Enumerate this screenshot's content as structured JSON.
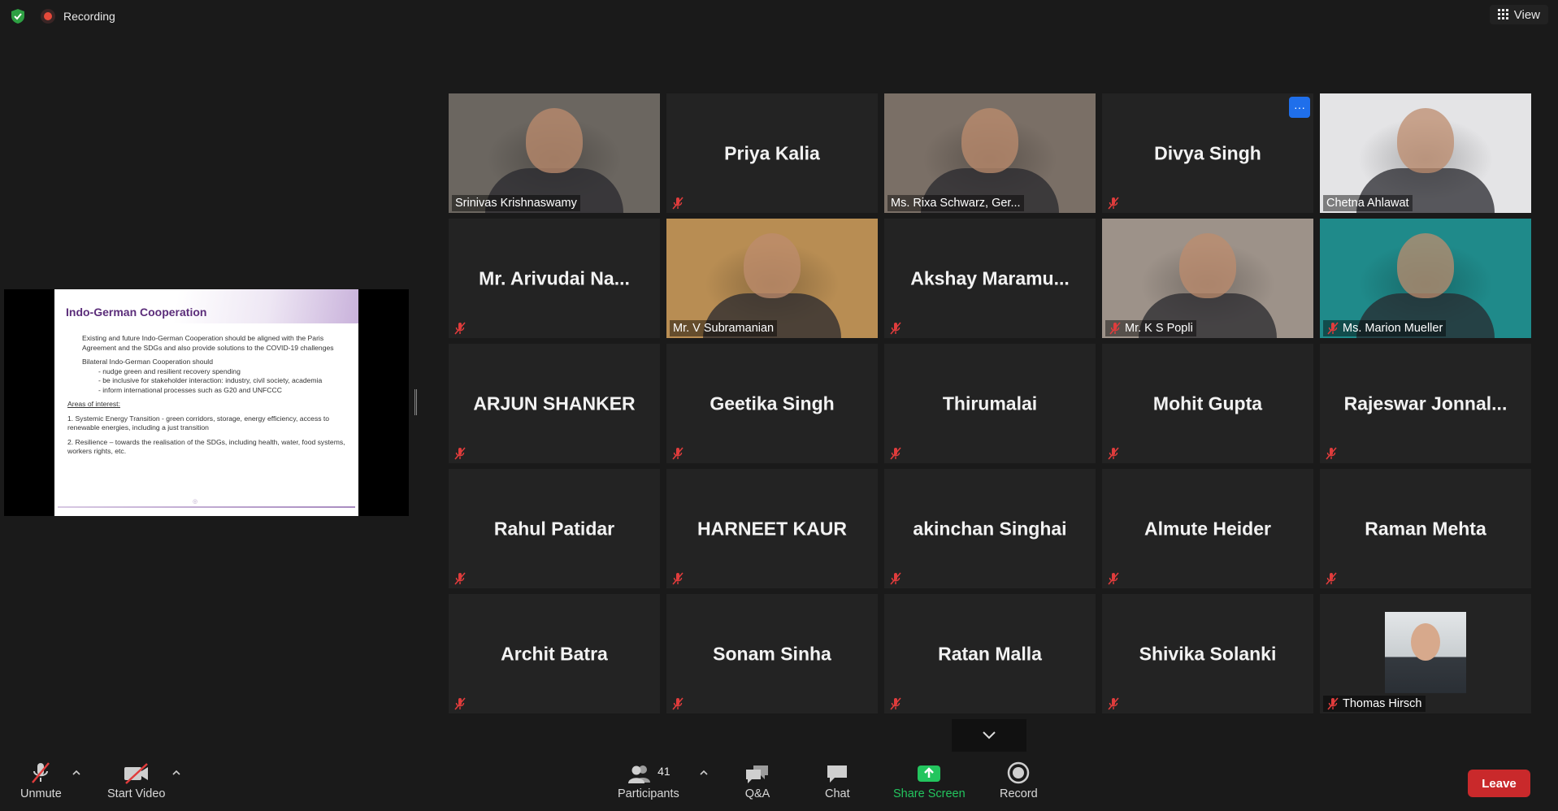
{
  "top": {
    "recording": "Recording",
    "view": "View"
  },
  "slide": {
    "title": "Indo-German Cooperation",
    "bullet1": "Existing and future Indo-German Cooperation should be aligned with the Paris Agreement and the SDGs and also provide solutions to the COVID-19 challenges",
    "bullet2": "Bilateral Indo-German Cooperation should",
    "sub1": "- nudge green and resilient recovery spending",
    "sub2": "- be inclusive for stakeholder interaction: industry, civil society, academia",
    "sub3": "- inform international processes such as G20 and UNFCCC",
    "areas_heading": "Areas of interest:",
    "area1": "1.   Systemic Energy Transition - green corridors, storage, energy efficiency, access to renewable energies, including a just transition",
    "area2": "2.   Resilience – towards the realisation of the SDGs, including health, water, food systems, workers rights, etc."
  },
  "participants": [
    {
      "name": "Srinivas Krishnaswamy",
      "video": true,
      "muted": false,
      "bg": "#6b6660"
    },
    {
      "name": "Priya Kalia",
      "video": false,
      "muted": true
    },
    {
      "name": "Ms. Rixa Schwarz, Ger...",
      "video": true,
      "muted": false,
      "active": true,
      "bg": "#7a6f66"
    },
    {
      "name": "Divya Singh",
      "video": false,
      "muted": true,
      "more": "···"
    },
    {
      "name": "Chetna Ahlawat",
      "video": true,
      "muted": false,
      "bg": "#e4e4e6"
    },
    {
      "name": "Mr. Arivudai Na...",
      "video": false,
      "muted": true
    },
    {
      "name": "Mr. V Subramanian",
      "video": true,
      "muted": false,
      "bg": "#b88d53"
    },
    {
      "name": "Akshay Maramu...",
      "video": false,
      "muted": true
    },
    {
      "name": "Mr. K S Popli",
      "video": true,
      "muted": true,
      "bg": "#9d9289"
    },
    {
      "name": "Ms. Marion Mueller",
      "video": true,
      "muted": true,
      "bg": "#1f8a8a"
    },
    {
      "name": "ARJUN SHANKER",
      "video": false,
      "muted": true
    },
    {
      "name": "Geetika Singh",
      "video": false,
      "muted": true
    },
    {
      "name": "Thirumalai",
      "video": false,
      "muted": true
    },
    {
      "name": "Mohit Gupta",
      "video": false,
      "muted": true
    },
    {
      "name": "Rajeswar Jonnal...",
      "video": false,
      "muted": true
    },
    {
      "name": "Rahul Patidar",
      "video": false,
      "muted": true
    },
    {
      "name": "HARNEET KAUR",
      "video": false,
      "muted": true
    },
    {
      "name": "akinchan Singhai",
      "video": false,
      "muted": true
    },
    {
      "name": "Almute Heider",
      "video": false,
      "muted": true
    },
    {
      "name": "Raman Mehta",
      "video": false,
      "muted": true
    },
    {
      "name": "Archit Batra",
      "video": false,
      "muted": true
    },
    {
      "name": "Sonam Sinha",
      "video": false,
      "muted": true
    },
    {
      "name": "Ratan Malla",
      "video": false,
      "muted": true
    },
    {
      "name": "Shivika Solanki",
      "video": false,
      "muted": true
    },
    {
      "name": "Thomas Hirsch",
      "video": "photo",
      "muted": true,
      "bg": "#cfd3d6"
    }
  ],
  "toolbar": {
    "unmute": "Unmute",
    "start_video": "Start Video",
    "participants": "Participants",
    "participant_count": "41",
    "qa": "Q&A",
    "chat": "Chat",
    "share": "Share Screen",
    "record": "Record",
    "leave": "Leave"
  }
}
